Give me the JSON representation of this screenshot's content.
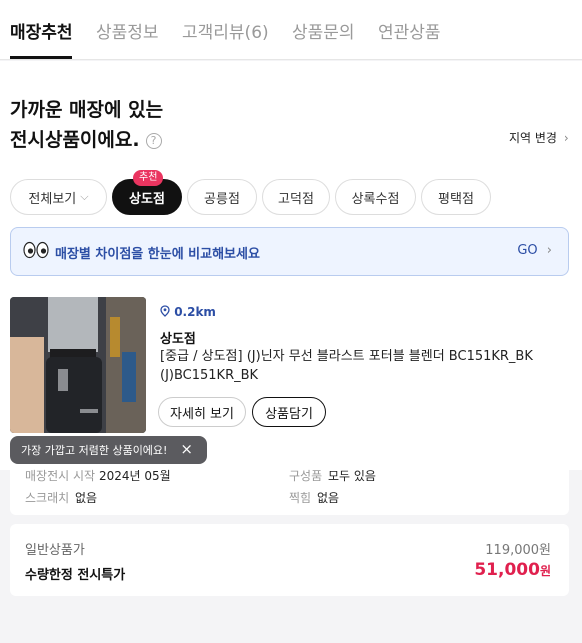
{
  "tabs": [
    "매장추천",
    "상품정보",
    "고객리뷰(6)",
    "상품문의",
    "연관상품"
  ],
  "headline": {
    "line1": "가까운 매장에 있는",
    "line2": "전시상품이에요."
  },
  "region_change": "지역 변경",
  "filters": {
    "all_label": "전체보기",
    "stores": [
      "상도점",
      "공릉점",
      "고덕점",
      "상록수점",
      "평택점"
    ],
    "badge": "추천"
  },
  "compare_banner": {
    "text": "매장별 차이점을 한눈에 비교해보세요",
    "action": "GO"
  },
  "product": {
    "distance": "0.2km",
    "store": "상도점",
    "name": "[중급 / 상도점] (J)닌자 무선 블라스트 포터블 블렌더 BC151KR_BK (J)BC151KR_BK",
    "detail_button": "자세히 보기",
    "cart_button": "상품담기"
  },
  "tooltip": "가장 가깝고 저렴한 상품이에요!",
  "info": {
    "display_start_label": "매장전시 시작",
    "display_start_value": "2024년 05월",
    "components_label": "구성품",
    "components_value": "모두 있음",
    "scratch_label": "스크래치",
    "scratch_value": "없음",
    "dent_label": "찍힘",
    "dent_value": "없음"
  },
  "price": {
    "regular_label": "일반상품가",
    "regular_value": "119,000원",
    "special_label": "수량한정 전시특가",
    "special_amount": "51,000",
    "special_unit": "원"
  },
  "colors": {
    "accent_blue": "#2c4ea5",
    "price_red": "#e0204e",
    "badge_pink": "#ea3560"
  }
}
